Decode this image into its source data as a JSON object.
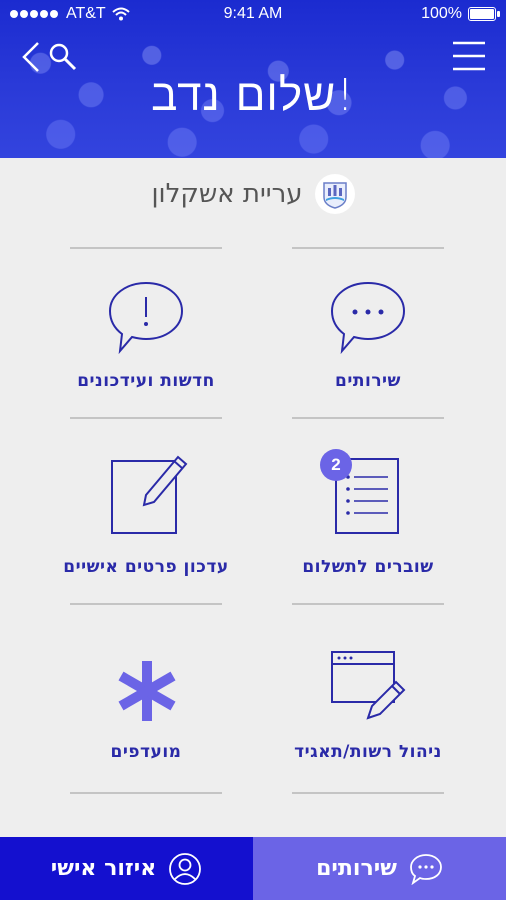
{
  "status_bar": {
    "carrier": "AT&T",
    "time": "9:41 AM",
    "battery": "100%"
  },
  "header": {
    "greeting": "שלום נדב!"
  },
  "city": {
    "name": "עריית אשקלון"
  },
  "tiles": [
    {
      "label": "שירותים",
      "icon": "speech-bubble-dots-icon"
    },
    {
      "label": "חדשות ועידכונים",
      "icon": "speech-bubble-exclamation-icon"
    },
    {
      "label": "שוברים לתשלום",
      "icon": "document-list-icon",
      "badge": "2"
    },
    {
      "label": "עדכון פרטים אישיים",
      "icon": "edit-pencil-icon"
    },
    {
      "label": "ניהול רשות/תאגיד",
      "icon": "browser-edit-icon"
    },
    {
      "label": "מועדפים",
      "icon": "asterisk-icon"
    }
  ],
  "bottom_nav": {
    "personal": "איזור אישי",
    "services": "שירותים"
  },
  "colors": {
    "primary": "#1410cf",
    "accent": "#6b64e6",
    "icon": "#2a2aa8",
    "background": "#eeeeee"
  }
}
